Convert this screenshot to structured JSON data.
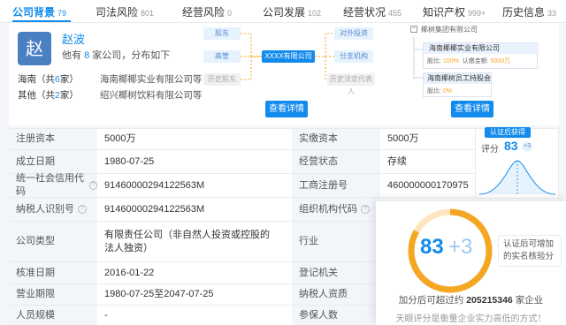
{
  "tabs": [
    {
      "label": "公司背景",
      "count": "79"
    },
    {
      "label": "司法风险",
      "count": "801"
    },
    {
      "label": "经营风险",
      "count": "0"
    },
    {
      "label": "公司发展",
      "count": "102"
    },
    {
      "label": "经营状况",
      "count": "455"
    },
    {
      "label": "知识产权",
      "count": "999+"
    },
    {
      "label": "历史信息",
      "count": "33"
    }
  ],
  "person": {
    "avatar_char": "赵",
    "name": "赵波",
    "summary_prefix": "他有",
    "company_count": "8",
    "summary_suffix": "家公司，分布如下",
    "regions": [
      {
        "name": "海南（共",
        "count": "6",
        "unit": "家）",
        "company": "海南椰椰实业有限公司等"
      },
      {
        "name": "其他（共",
        "count": "2",
        "unit": "家）",
        "company": "绍兴椰树饮料有限公司等"
      }
    ]
  },
  "diagram": {
    "shareholder": "股东",
    "executive": "高管",
    "center": "XXXX有限公司",
    "investment": "对外投资",
    "branch": "分支机构",
    "history_shareholder": "历史股东",
    "history_legal": "历史法定代表人"
  },
  "org": {
    "parent": "椰树集团有限公司",
    "child1": "海南椰椰实业有限公司",
    "ratio_label": "股比:",
    "ratio1": "100%",
    "capital_label": "认缴金额:",
    "capital1": "5000万",
    "child2": "海南椰树员工持股会",
    "ratio2": "0%"
  },
  "buttons": {
    "detail1": "查看详情",
    "detail2": "查看详情"
  },
  "table": {
    "rows": [
      {
        "l1": "注册资本",
        "v1": "5000万",
        "l2": "实缴资本",
        "v2": "5000万",
        "q1": false,
        "q2": false
      },
      {
        "l1": "成立日期",
        "v1": "1980-07-25",
        "l2": "经营状态",
        "v2": "存续",
        "q1": false,
        "q2": false
      },
      {
        "l1": "统一社会信用代码",
        "v1": "91460000294122563M",
        "l2": "工商注册号",
        "v2": "460000000170975",
        "q1": true,
        "q2": false
      },
      {
        "l1": "纳税人识别号",
        "v1": "91460000294122563M",
        "l2": "组织机构代码",
        "v2": "",
        "q1": true,
        "q2": true
      },
      {
        "l1": "公司类型",
        "v1": "有限责任公司（非自然人投资或控股的法人独资）",
        "l2": "行业",
        "v2": "",
        "q1": false,
        "q2": false
      },
      {
        "l1": "核准日期",
        "v1": "2016-01-22",
        "l2": "登记机关",
        "v2": "",
        "q1": false,
        "q2": false
      },
      {
        "l1": "营业期限",
        "v1": "1980-07-25至2047-07-25",
        "l2": "纳税人资质",
        "v2": "",
        "q1": false,
        "q2": false
      },
      {
        "l1": "人员规模",
        "v1": "-",
        "l2": "参保人数",
        "v2": "",
        "q1": false,
        "q2": false
      }
    ]
  },
  "score": {
    "badge": "认证后获得",
    "label": "评分",
    "value": "83",
    "plus": "+3",
    "big_value": "83",
    "big_plus": "+3",
    "hint": "认证后可增加的实名核验分",
    "exceed_prefix": "加分后可超过约",
    "exceed_count": "205215346",
    "exceed_suffix": "家企业",
    "footer": "天眼评分是衡量企业实力高低的方式！",
    "colors": {
      "accent": "#128bed",
      "ring": "#f5a623"
    }
  }
}
